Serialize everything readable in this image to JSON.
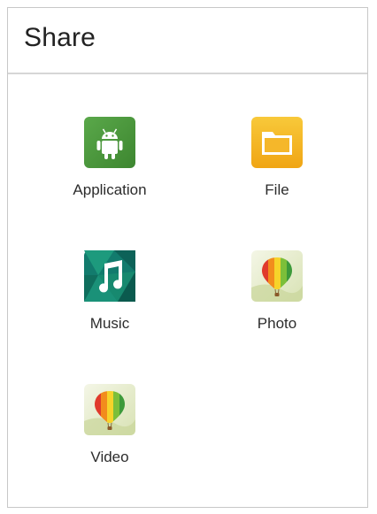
{
  "header": {
    "title": "Share"
  },
  "share_options": [
    {
      "label": "Application",
      "icon": "android-icon"
    },
    {
      "label": "File",
      "icon": "folder-icon"
    },
    {
      "label": "Music",
      "icon": "music-note-icon"
    },
    {
      "label": "Photo",
      "icon": "balloon-icon"
    },
    {
      "label": "Video",
      "icon": "balloon-icon"
    }
  ],
  "colors": {
    "application_bg": "#4f9a3d",
    "file_bg": "#f4b81f",
    "music_bg": "#127b6d",
    "photo_bg": "#eef2d8",
    "text": "#2c2c2c",
    "divider": "#d6d6d6"
  }
}
